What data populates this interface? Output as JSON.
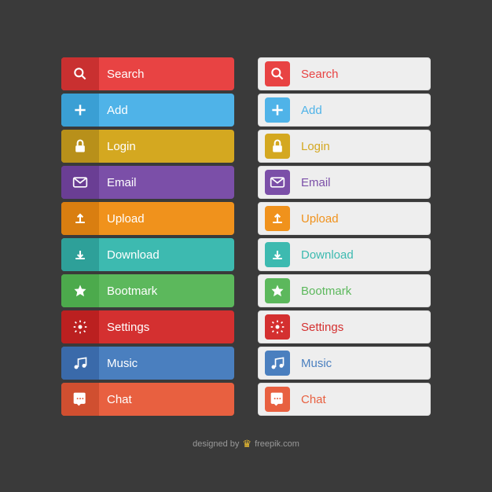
{
  "buttons": [
    {
      "id": "search",
      "label": "Search",
      "color": "red",
      "iconType": "search"
    },
    {
      "id": "add",
      "label": "Add",
      "color": "blue",
      "iconType": "plus"
    },
    {
      "id": "login",
      "label": "Login",
      "color": "gold",
      "iconType": "lock"
    },
    {
      "id": "email",
      "label": "Email",
      "color": "purple",
      "iconType": "email"
    },
    {
      "id": "upload",
      "label": "Upload",
      "color": "orange",
      "iconType": "upload"
    },
    {
      "id": "download",
      "label": "Download",
      "color": "teal",
      "iconType": "download"
    },
    {
      "id": "bookmark",
      "label": "Bootmark",
      "color": "green",
      "iconType": "star"
    },
    {
      "id": "settings",
      "label": "Settings",
      "color": "crimson",
      "iconType": "gear"
    },
    {
      "id": "music",
      "label": "Music",
      "color": "navy",
      "iconType": "music"
    },
    {
      "id": "chat",
      "label": "Chat",
      "color": "coral",
      "iconType": "chat"
    }
  ],
  "footer": {
    "text": "designed by",
    "brand": "freepik.com"
  }
}
